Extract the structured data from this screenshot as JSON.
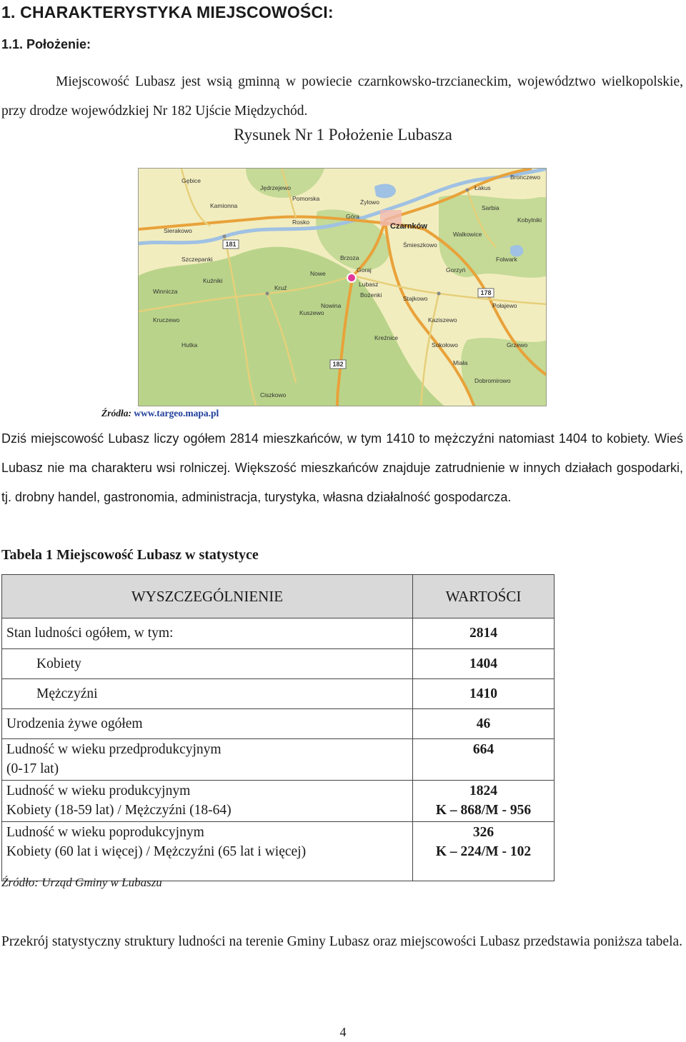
{
  "heading1": "1. CHARAKTERYSTYKA MIEJSCOWOŚCI:",
  "heading2": "1.1. Położenie:",
  "para1": "Miejscowość Lubasz jest wsią gminną w powiecie czarnkowsko-trzcianeckim, województwo wielkopolskie, przy drodze wojewódzkiej Nr 182 Ujście Międzychód.",
  "figure_caption": "Rysunek Nr 1 Położenie Lubasza",
  "map": {
    "labels": {
      "czarnkow": "Czarnków",
      "lubasz": "Lubasz",
      "gora": "Góra",
      "rosko": "Rosko",
      "pomorska": "Pomorska",
      "smieszkowo": "Śmieszkowo",
      "brzoza": "Brzoza",
      "kruz": "Kruź",
      "kuszewo": "Kuszewo",
      "stajkowo": "Stajkowo",
      "gorzyn": "Gorzyń",
      "kaziszewo": "Kaziszewo",
      "sokolowo": "Sokołowo",
      "sierakow": "Sierakowo",
      "polajewo": "Połajewo",
      "szczepanki": "Szczepanki",
      "sarbia": "Sarbia",
      "kamionna": "Kamionna",
      "lakus": "Łakus",
      "jadzewo": "Jędrzejewo",
      "walkowice": "Walkowice",
      "zylowo": "Żylowo",
      "folwark": "Folwark",
      "winnicza": "Winnicza",
      "kruczewo": "Kruczewo",
      "miala": "Miała",
      "goraj": "Goraj",
      "bronczewo": "Bronczewo",
      "dobromirowo": "Dobromirowo",
      "nowina": "Nowina",
      "bozenki": "Bożenki",
      "kuzniki": "Kuźniki",
      "ciszkowo": "Ciszkowo",
      "hutka": "Hutka",
      "grzewo": "Grzewo",
      "nowe": "Nowe",
      "kobylniki": "Kobylniki",
      "gebice": "Gębice",
      "kreznice": "Kreźnice"
    },
    "road_numbers": [
      "181",
      "182",
      "178",
      "182",
      "178"
    ],
    "accent_colors": {
      "land": "#f2edbf",
      "forest": "#b9d48a",
      "water": "#9fc1e3",
      "road_major": "#e8a23a",
      "road_minor": "#e6cf7a",
      "marker": "#e23a9a"
    }
  },
  "map_source_label": "Źródła:",
  "map_source_url": "www.targeo.mapa.pl",
  "para2": "Dziś miejscowość Lubasz liczy ogółem 2814 mieszkańców, w tym 1410 to mężczyźni natomiast 1404 to kobiety. Wieś Lubasz nie ma charakteru wsi rolniczej. Większość mieszkańców znajduje zatrudnienie w innych działach gospodarki, tj. drobny handel, gastronomia, administracja, turystyka, własna działalność gospodarcza.",
  "table_caption": "Tabela 1 Miejscowość Lubasz w statystyce",
  "table": {
    "col1": "WYSZCZEGÓLNIENIE",
    "col2": "WARTOŚCI",
    "rows": [
      {
        "label": "Stan ludności ogółem, w tym:",
        "value": "2814"
      },
      {
        "label": "Kobiety",
        "value": "1404"
      },
      {
        "label": "Mężczyźni",
        "value": "1410"
      },
      {
        "label": "Urodzenia żywe ogółem",
        "value": "46"
      },
      {
        "label_l1": "Ludność w wieku przedprodukcyjnym",
        "label_l2": "(0-17 lat)",
        "value": "664"
      },
      {
        "label_l1": "Ludność w wieku produkcyjnym",
        "label_l2": "Kobiety (18-59 lat) / Mężczyźni (18-64)",
        "value_l1": "1824",
        "value_l2": "K – 868/M - 956"
      },
      {
        "label_l1": "Ludność w wieku poprodukcyjnym",
        "label_l2": "Kobiety (60 lat i więcej) / Mężczyźni (65 lat i więcej)",
        "value_l1": "326",
        "value_l2": "K – 224/M - 102"
      }
    ]
  },
  "table_source": "Źródło: Urząd Gminy w Lubaszu",
  "para3": "Przekrój statystyczny struktury ludności na terenie Gminy Lubasz oraz miejscowości Lubasz przedstawia poniższa tabela.",
  "page_number": "4"
}
